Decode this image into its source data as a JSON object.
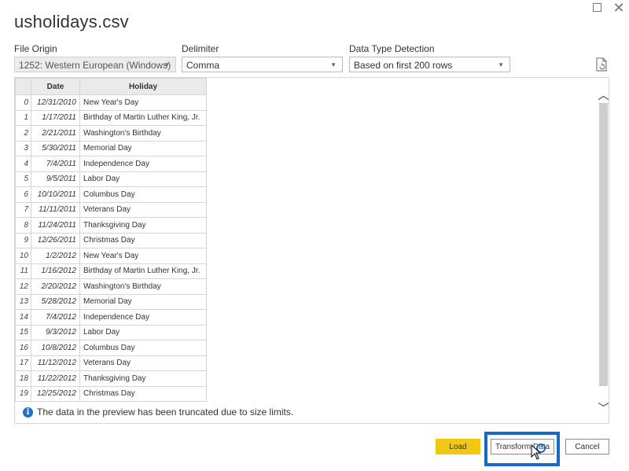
{
  "window": {
    "title": "usholidays.csv"
  },
  "options": {
    "file_origin": {
      "label": "File Origin",
      "value": "1252: Western European (Windows)"
    },
    "delimiter": {
      "label": "Delimiter",
      "value": "Comma"
    },
    "detection": {
      "label": "Data Type Detection",
      "value": "Based on first 200 rows"
    }
  },
  "table": {
    "columns": [
      "Date",
      "Holiday"
    ],
    "rows": [
      {
        "idx": "0",
        "date": "12/31/2010",
        "holiday": "New Year's Day"
      },
      {
        "idx": "1",
        "date": "1/17/2011",
        "holiday": "Birthday of Martin Luther King, Jr."
      },
      {
        "idx": "2",
        "date": "2/21/2011",
        "holiday": "Washington's Birthday"
      },
      {
        "idx": "3",
        "date": "5/30/2011",
        "holiday": "Memorial Day"
      },
      {
        "idx": "4",
        "date": "7/4/2011",
        "holiday": "Independence Day"
      },
      {
        "idx": "5",
        "date": "9/5/2011",
        "holiday": "Labor Day"
      },
      {
        "idx": "6",
        "date": "10/10/2011",
        "holiday": "Columbus Day"
      },
      {
        "idx": "7",
        "date": "11/11/2011",
        "holiday": "Veterans Day"
      },
      {
        "idx": "8",
        "date": "11/24/2011",
        "holiday": "Thanksgiving Day"
      },
      {
        "idx": "9",
        "date": "12/26/2011",
        "holiday": "Christmas Day"
      },
      {
        "idx": "10",
        "date": "1/2/2012",
        "holiday": "New Year's Day"
      },
      {
        "idx": "11",
        "date": "1/16/2012",
        "holiday": "Birthday of Martin Luther King, Jr."
      },
      {
        "idx": "12",
        "date": "2/20/2012",
        "holiday": "Washington's Birthday"
      },
      {
        "idx": "13",
        "date": "5/28/2012",
        "holiday": "Memorial Day"
      },
      {
        "idx": "14",
        "date": "7/4/2012",
        "holiday": "Independence Day"
      },
      {
        "idx": "15",
        "date": "9/3/2012",
        "holiday": "Labor Day"
      },
      {
        "idx": "16",
        "date": "10/8/2012",
        "holiday": "Columbus Day"
      },
      {
        "idx": "17",
        "date": "11/12/2012",
        "holiday": "Veterans Day"
      },
      {
        "idx": "18",
        "date": "11/22/2012",
        "holiday": "Thanksgiving Day"
      },
      {
        "idx": "19",
        "date": "12/25/2012",
        "holiday": "Christmas Day"
      }
    ]
  },
  "info": {
    "icon": "info-icon",
    "text": "The data in the preview has been truncated due to size limits."
  },
  "buttons": {
    "load": "Load",
    "transform": "Transform Data",
    "cancel": "Cancel"
  },
  "colors": {
    "load_button": "#f2c811",
    "highlight_box": "#1769c4",
    "info_icon": "#1a73c8"
  }
}
